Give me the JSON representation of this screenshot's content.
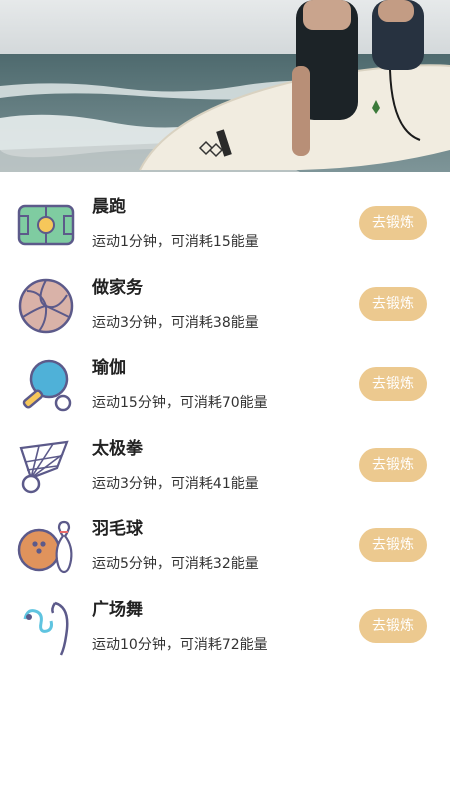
{
  "banner": {
    "image": "surfers-with-surfboards-on-beach"
  },
  "colors": {
    "accent": "#ecc98f",
    "title_text": "#222222",
    "body_text": "#333333"
  },
  "activities": [
    {
      "title": "晨跑",
      "desc": "运动1分钟，可消耗15能量",
      "button": "去锻炼",
      "icon": "soccer-field-icon"
    },
    {
      "title": "做家务",
      "desc": "运动3分钟，可消耗38能量",
      "button": "去锻炼",
      "icon": "volleyball-icon"
    },
    {
      "title": "瑜伽",
      "desc": "运动15分钟，可消耗70能量",
      "button": "去锻炼",
      "icon": "ping-pong-icon"
    },
    {
      "title": "太极拳",
      "desc": "运动3分钟，可消耗41能量",
      "button": "去锻炼",
      "icon": "shuttlecock-icon"
    },
    {
      "title": "羽毛球",
      "desc": "运动5分钟，可消耗32能量",
      "button": "去锻炼",
      "icon": "bowling-icon"
    },
    {
      "title": "广场舞",
      "desc": "运动10分钟，可消耗72能量",
      "button": "去锻炼",
      "icon": "ribbon-dance-icon"
    }
  ]
}
